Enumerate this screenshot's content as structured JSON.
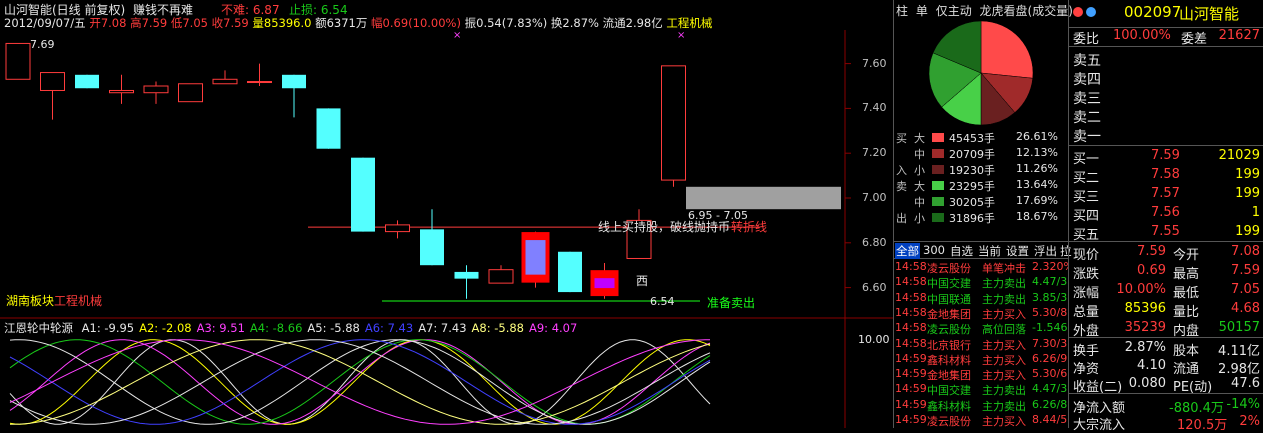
{
  "header": {
    "stock_name": "山河智能(日线 前复权)",
    "slogan": "赚钱不再难",
    "pressure_label": "不难: 6.87",
    "stop_label": "止损: 6.54"
  },
  "ohlc_line": {
    "date": "2012/09/07/五",
    "open": "开7.08",
    "high": "高7.59",
    "low": "低7.05",
    "close": "收7.59",
    "volume": "量85396.0",
    "amount": "额6371万",
    "amplitude_pct": "幅0.69(10.00%)",
    "swing": "振0.54(7.83%)",
    "turnover": "换2.87%",
    "float": "流通2.98亿",
    "sector": "工程机械"
  },
  "chart_labels": {
    "top_price": "7.69",
    "annotation": "线上买持股，破线抛持币",
    "annotation_accent": "转折线",
    "range_label": "6.95 - 7.05",
    "low_marker": "6.54",
    "ready_sell": "准备卖出",
    "west_marker": "西",
    "sector_prefix": "湖南板块",
    "sector_name": "工程机械"
  },
  "price_axis": [
    "7.60",
    "7.40",
    "7.20",
    "7.00",
    "6.80",
    "6.60"
  ],
  "indicator": {
    "name": "江恩轮中轮源",
    "values": [
      {
        "label": "A1: -9.95",
        "color": "#e6e6e6"
      },
      {
        "label": "A2: -2.08",
        "color": "#ffff00"
      },
      {
        "label": "A3: 9.51",
        "color": "#ff40ff"
      },
      {
        "label": "A4: -8.66",
        "color": "#19c819"
      },
      {
        "label": "A5: -5.88",
        "color": "#e6e6e6"
      },
      {
        "label": "A6: 7.43",
        "color": "#4040ff"
      },
      {
        "label": "A7: 7.43",
        "color": "#e6e6e6"
      },
      {
        "label": "A8: -5.88",
        "color": "#ffff80"
      },
      {
        "label": "A9: 4.07",
        "color": "#ff40ff"
      }
    ],
    "axis_label": "10.00"
  },
  "candles": [
    {
      "o": 7.53,
      "c": 7.69,
      "h": 7.69,
      "l": 7.53,
      "up": true
    },
    {
      "o": 7.48,
      "c": 7.56,
      "h": 7.56,
      "l": 7.35,
      "up": true
    },
    {
      "o": 7.55,
      "c": 7.49,
      "h": 7.55,
      "l": 7.49,
      "up": false
    },
    {
      "o": 7.48,
      "c": 7.47,
      "h": 7.55,
      "l": 7.42,
      "up": true
    },
    {
      "o": 7.47,
      "c": 7.5,
      "h": 7.52,
      "l": 7.42,
      "up": true
    },
    {
      "o": 7.43,
      "c": 7.51,
      "h": 7.51,
      "l": 7.43,
      "up": true
    },
    {
      "o": 7.51,
      "c": 7.53,
      "h": 7.57,
      "l": 7.51,
      "up": true
    },
    {
      "o": 7.52,
      "c": 7.52,
      "h": 7.6,
      "l": 7.5,
      "up": true
    },
    {
      "o": 7.55,
      "c": 7.49,
      "h": 7.55,
      "l": 7.36,
      "up": false
    },
    {
      "o": 7.4,
      "c": 7.22,
      "h": 7.4,
      "l": 7.22,
      "up": false
    },
    {
      "o": 7.18,
      "c": 6.85,
      "h": 7.18,
      "l": 6.85,
      "up": false
    },
    {
      "o": 6.85,
      "c": 6.88,
      "h": 6.9,
      "l": 6.82,
      "up": true
    },
    {
      "o": 6.86,
      "c": 6.7,
      "h": 6.95,
      "l": 6.7,
      "up": false
    },
    {
      "o": 6.67,
      "c": 6.64,
      "h": 6.7,
      "l": 6.55,
      "up": false
    },
    {
      "o": 6.62,
      "c": 6.68,
      "h": 6.7,
      "l": 6.62,
      "up": true
    },
    {
      "o": 6.64,
      "c": 6.83,
      "h": 6.85,
      "l": 6.6,
      "up": true
    },
    {
      "o": 6.76,
      "c": 6.58,
      "h": 6.76,
      "l": 6.58,
      "up": false
    },
    {
      "o": 6.58,
      "c": 6.66,
      "h": 6.71,
      "l": 6.55,
      "up": true
    },
    {
      "o": 6.73,
      "c": 6.9,
      "h": 6.95,
      "l": 6.73,
      "up": true
    },
    {
      "o": 7.08,
      "c": 7.59,
      "h": 7.59,
      "l": 7.05,
      "up": true
    }
  ],
  "mid_panel": {
    "tabs": [
      "柱",
      "单",
      "仅主动",
      "龙虎看盘(成交量)"
    ],
    "pie": [
      {
        "value": 26.61,
        "color": "#ff4a4a"
      },
      {
        "value": 12.13,
        "color": "#a02a2a"
      },
      {
        "value": 11.26,
        "color": "#6a2020"
      },
      {
        "value": 13.64,
        "color": "#48d048"
      },
      {
        "value": 17.69,
        "color": "#30a030"
      },
      {
        "value": 18.67,
        "color": "#1a6a1a"
      }
    ],
    "buy_label": "买",
    "sell_label": "卖",
    "rows": [
      {
        "side": "买",
        "size": "大",
        "vol": "45453手",
        "pct": "26.61%",
        "color": "#ff4a4a"
      },
      {
        "side": "",
        "size": "中",
        "vol": "20709手",
        "pct": "12.13%",
        "color": "#a02a2a"
      },
      {
        "side": "入",
        "size": "小",
        "vol": "19230手",
        "pct": "11.26%",
        "color": "#6a2020"
      },
      {
        "side": "卖",
        "size": "大",
        "vol": "23295手",
        "pct": "13.64%",
        "color": "#48d048"
      },
      {
        "side": "",
        "size": "中",
        "vol": "30205手",
        "pct": "17.69%",
        "color": "#30a030"
      },
      {
        "side": "出",
        "size": "小",
        "vol": "31896手",
        "pct": "18.67%",
        "color": "#1a6a1a"
      }
    ],
    "filter_tabs": [
      "全部",
      "300",
      "自选",
      "当前",
      "设置",
      "浮出",
      "拉"
    ],
    "trades": [
      {
        "time": "14:58",
        "name": "凌云股份",
        "name_color": "#ff3c3c",
        "action": "单笔冲击",
        "action_color": "#ff3c3c",
        "val": "2.320%",
        "val_color": "#ff3c3c"
      },
      {
        "time": "14:58",
        "name": "中国交建",
        "name_color": "#19c819",
        "action": "主力卖出",
        "action_color": "#19c819",
        "val": "4.47/3",
        "val_color": "#19c819"
      },
      {
        "time": "14:58",
        "name": "中国联通",
        "name_color": "#19c819",
        "action": "主力卖出",
        "action_color": "#19c819",
        "val": "3.85/3",
        "val_color": "#19c819"
      },
      {
        "time": "14:58",
        "name": "金地集团",
        "name_color": "#ff3c3c",
        "action": "主力买入",
        "action_color": "#ff3c3c",
        "val": "5.30/8",
        "val_color": "#ff3c3c"
      },
      {
        "time": "14:58",
        "name": "凌云股份",
        "name_color": "#19c819",
        "action": "高位回落",
        "action_color": "#19c819",
        "val": "-1.546",
        "val_color": "#19c819"
      },
      {
        "time": "14:58",
        "name": "北京银行",
        "name_color": "#ff3c3c",
        "action": "主力买入",
        "action_color": "#ff3c3c",
        "val": "7.30/3",
        "val_color": "#ff3c3c"
      },
      {
        "time": "14:59",
        "name": "鑫科材料",
        "name_color": "#ff3c3c",
        "action": "主力买入",
        "action_color": "#ff3c3c",
        "val": "6.26/9",
        "val_color": "#ff3c3c"
      },
      {
        "time": "14:59",
        "name": "金地集团",
        "name_color": "#ff3c3c",
        "action": "主力买入",
        "action_color": "#ff3c3c",
        "val": "5.30/6",
        "val_color": "#ff3c3c"
      },
      {
        "time": "14:59",
        "name": "中国交建",
        "name_color": "#19c819",
        "action": "主力卖出",
        "action_color": "#19c819",
        "val": "4.47/3",
        "val_color": "#19c819"
      },
      {
        "time": "14:59",
        "name": "鑫科材料",
        "name_color": "#19c819",
        "action": "主力卖出",
        "action_color": "#19c819",
        "val": "6.26/8",
        "val_color": "#19c819"
      },
      {
        "time": "14:59",
        "name": "凌云股份",
        "name_color": "#ff3c3c",
        "action": "主力买入",
        "action_color": "#ff3c3c",
        "val": "8.44/5",
        "val_color": "#ff3c3c"
      }
    ]
  },
  "right_panel": {
    "code": "002097",
    "name": "山河智能",
    "weibi_label": "委比",
    "weibi_value": "100.00%",
    "weicha_label": "委差",
    "weicha_value": "21627",
    "sells": [
      "卖五",
      "卖四",
      "卖三",
      "卖二",
      "卖一"
    ],
    "buys": [
      {
        "label": "买一",
        "price": "7.59",
        "vol": "21029"
      },
      {
        "label": "买二",
        "price": "7.58",
        "vol": "199"
      },
      {
        "label": "买三",
        "price": "7.57",
        "vol": "199"
      },
      {
        "label": "买四",
        "price": "7.56",
        "vol": "1"
      },
      {
        "label": "买五",
        "price": "7.55",
        "vol": "199"
      }
    ],
    "stats": [
      {
        "l1": "现价",
        "v1": "7.59",
        "c1": "#ff3c3c",
        "l2": "今开",
        "v2": "7.08",
        "c2": "#ff3c3c"
      },
      {
        "l1": "涨跌",
        "v1": "0.69",
        "c1": "#ff3c3c",
        "l2": "最高",
        "v2": "7.59",
        "c2": "#ff3c3c"
      },
      {
        "l1": "涨幅",
        "v1": "10.00%",
        "c1": "#ff3c3c",
        "l2": "最低",
        "v2": "7.05",
        "c2": "#ff3c3c"
      },
      {
        "l1": "总量",
        "v1": "85396",
        "c1": "#ffff00",
        "l2": "量比",
        "v2": "4.68",
        "c2": "#ff3c3c"
      },
      {
        "l1": "外盘",
        "v1": "35239",
        "c1": "#ff3c3c",
        "l2": "内盘",
        "v2": "50157",
        "c2": "#19c819"
      }
    ],
    "stats2": [
      {
        "l1": "换手",
        "v1": "2.87%",
        "c1": "#e6e6e6",
        "l2": "股本",
        "v2": "4.11亿",
        "c2": "#e6e6e6"
      },
      {
        "l1": "净资",
        "v1": "4.10",
        "c1": "#e6e6e6",
        "l2": "流通",
        "v2": "2.98亿",
        "c2": "#e6e6e6"
      },
      {
        "l1": "收益(二)",
        "v1": "0.080",
        "c1": "#e6e6e6",
        "l2": "PE(动)",
        "v2": "47.6",
        "c2": "#e6e6e6"
      }
    ],
    "flow_label": "净流入额",
    "flow_value": "-880.4万",
    "flow_pct": "-14%",
    "big_label": "大宗流入",
    "big_value": "120.5万",
    "big_pct": "2%"
  },
  "colors": {
    "up": "#ff3c3c",
    "down_fill": "#54ffff",
    "axis": "#8a0000",
    "grid": "#555555"
  }
}
